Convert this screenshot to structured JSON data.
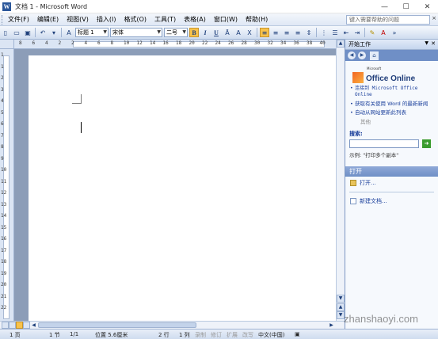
{
  "window": {
    "title": "文档 1 - Microsoft Word",
    "minimize": "—",
    "maximize": "☐",
    "close": "✕"
  },
  "menu": {
    "items": [
      "文件(F)",
      "编辑(E)",
      "视图(V)",
      "插入(I)",
      "格式(O)",
      "工具(T)",
      "表格(A)",
      "窗口(W)",
      "帮助(H)"
    ],
    "help_search_placeholder": "键入需要帮助的问题",
    "close_doc": "×"
  },
  "toolbar": {
    "style_value": "标题 1",
    "font_value": "宋体",
    "size_value": "二号",
    "bold": "B",
    "italic": "I",
    "underline": "U",
    "font_color_letter": "A",
    "highlight_letter": "A"
  },
  "ruler": {
    "h_numbers": [
      "8",
      "6",
      "4",
      "2",
      "2",
      "4",
      "6",
      "8",
      "10",
      "12",
      "14",
      "16",
      "18",
      "20",
      "22",
      "24",
      "26",
      "28",
      "30",
      "32",
      "34",
      "36",
      "38",
      "40"
    ],
    "v_numbers": [
      "1",
      "1",
      "2",
      "3",
      "4",
      "5",
      "6",
      "7",
      "8",
      "9",
      "10",
      "11",
      "12",
      "13",
      "14",
      "15",
      "16",
      "17",
      "18",
      "19",
      "20",
      "21",
      "22"
    ]
  },
  "taskpane": {
    "title": "开始工作",
    "office_small": "Microsoft",
    "office_logo": "Office Online",
    "links": [
      "连接到 Microsoft Office Online",
      "获取有关使用 Word 的最新新闻",
      "自动从网站更新此列表"
    ],
    "more": "其他",
    "search_label": "搜索:",
    "search_example": "示例: \"打印多个副本\"",
    "open_section": "打开",
    "open_item": "打开...",
    "new_doc_item": "新建文档..."
  },
  "status": {
    "page": "1 页",
    "section": "1 节",
    "pages": "1/1",
    "position": "位置 5.6厘米",
    "line": "2 行",
    "column": "1 列",
    "rec": "录制",
    "trk": "修订",
    "ext": "扩展",
    "ovr": "改写",
    "language": "中文(中国)"
  },
  "watermark": "zhanshaoyi.com",
  "colors": {
    "accent": "#f8c24a",
    "pane_header": "#6f8fc6",
    "link": "#1a3f9b"
  }
}
